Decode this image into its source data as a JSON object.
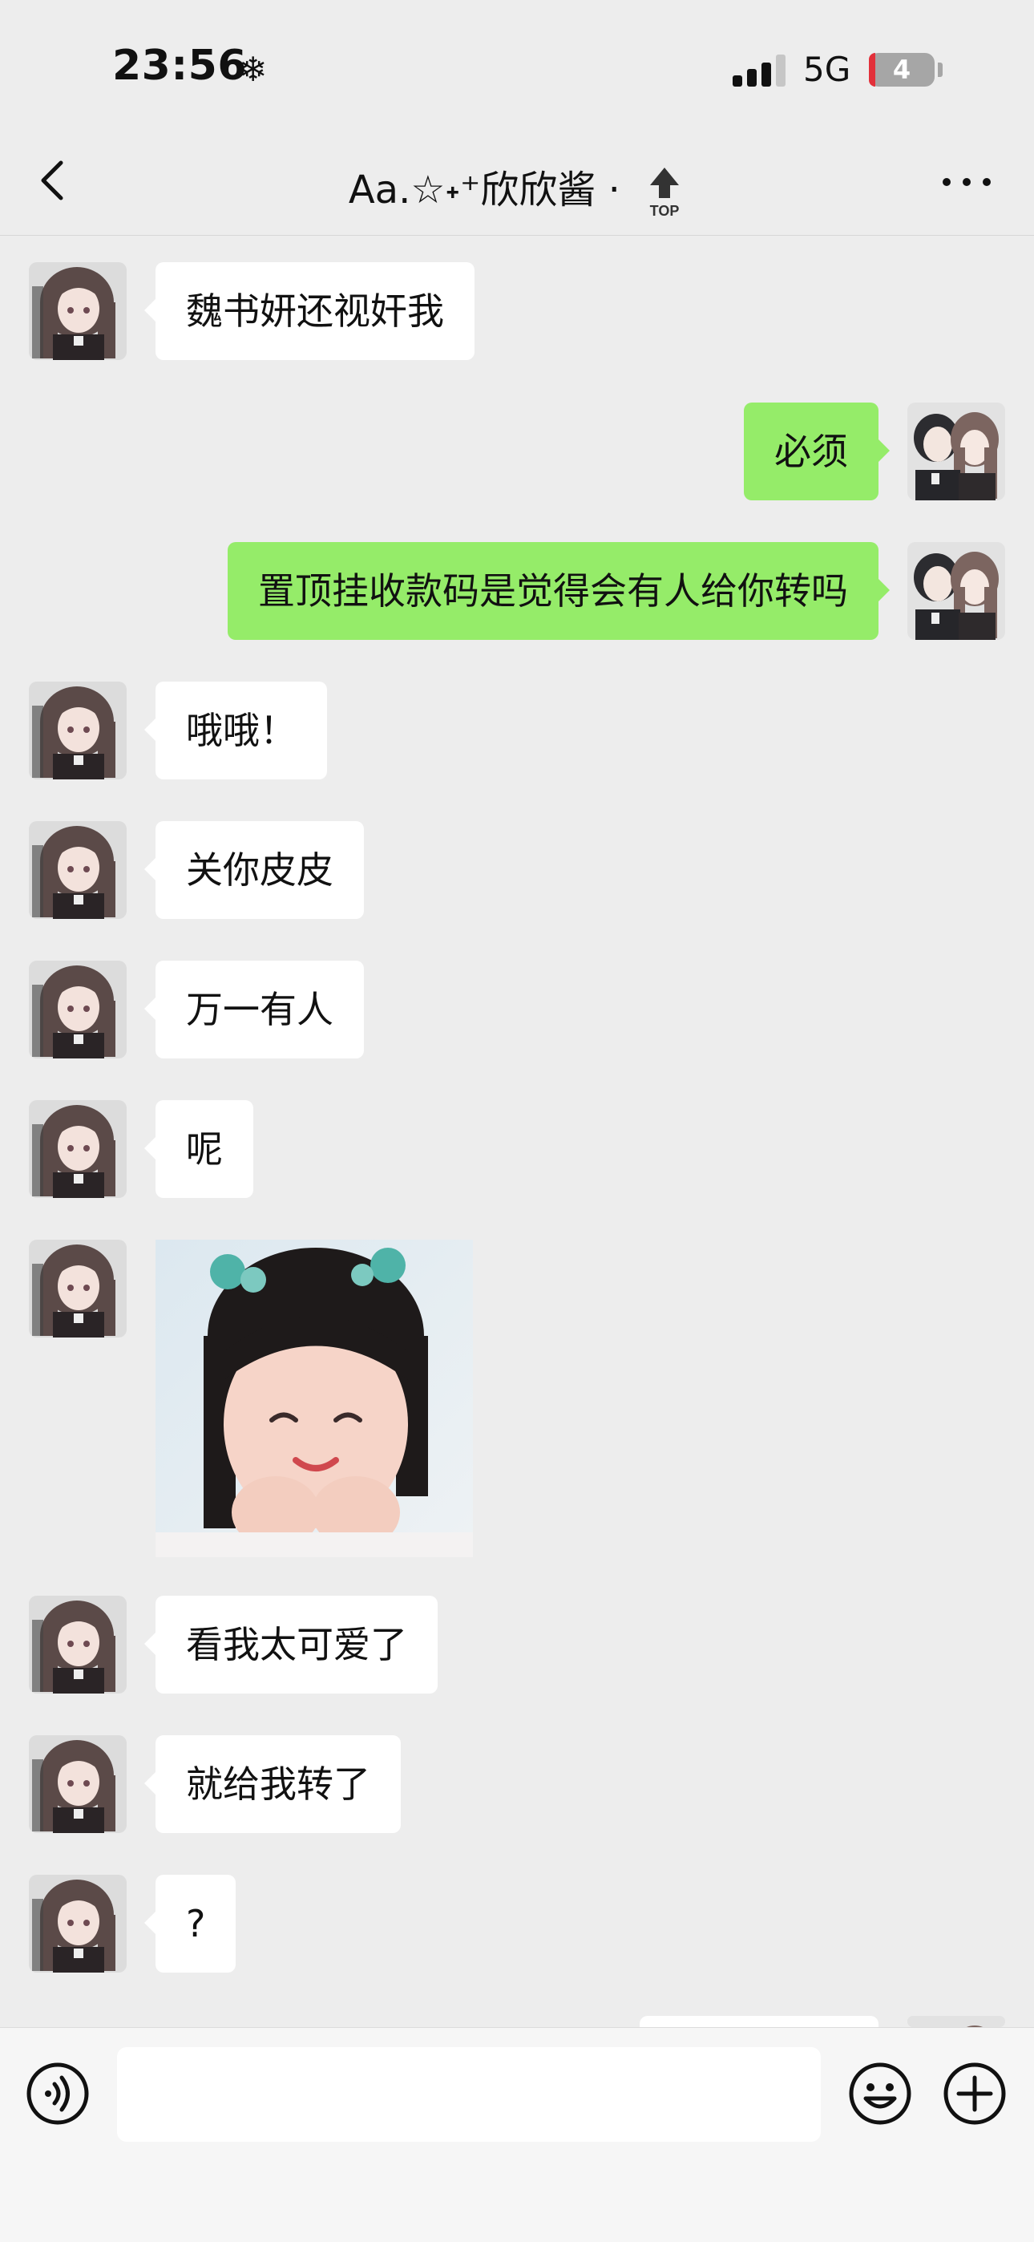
{
  "status_bar": {
    "time": "23:56",
    "network": "5G",
    "battery": "4"
  },
  "nav": {
    "title": "Aa.☆˖⁺欣欣酱 ·",
    "pin_badge": "TOP"
  },
  "messages": [
    {
      "side": "in",
      "text": "魏书妍还视奸我"
    },
    {
      "side": "out",
      "text": "必须"
    },
    {
      "side": "out",
      "text": "置顶挂收款码是觉得会有人给你转吗"
    },
    {
      "side": "in",
      "text": "哦哦！"
    },
    {
      "side": "in",
      "text": "关你皮皮"
    },
    {
      "side": "in",
      "text": "万一有人"
    },
    {
      "side": "in",
      "text": "呢"
    },
    {
      "side": "in",
      "type": "sticker"
    },
    {
      "side": "in",
      "text": "看我太可爱了"
    },
    {
      "side": "in",
      "text": "就给我转了"
    },
    {
      "side": "in",
      "text": "?"
    }
  ],
  "input": {
    "placeholder": ""
  },
  "icons": {
    "back": "chevron-left-icon",
    "pin": "pin-top-icon",
    "more": "more-icon",
    "voice": "voice-icon",
    "emoji": "emoji-icon",
    "plus": "plus-icon"
  },
  "colors": {
    "background": "#ededed",
    "incoming_bubble": "#ffffff",
    "outgoing_bubble": "#95ec69"
  }
}
